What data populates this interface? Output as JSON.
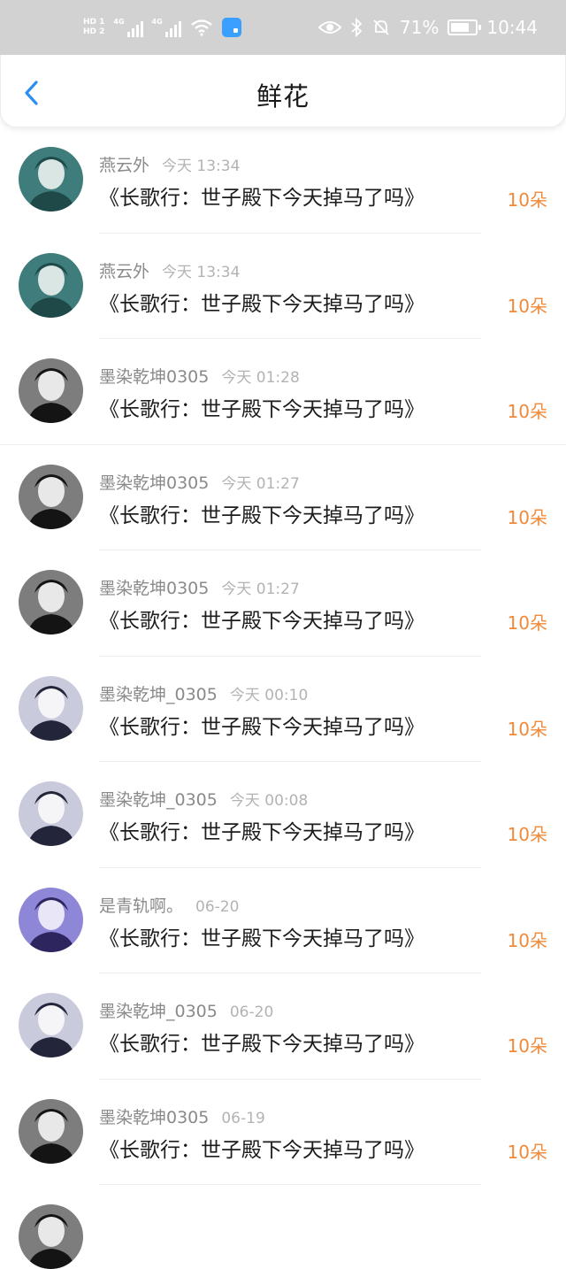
{
  "status_bar": {
    "hd1": "HD 1",
    "hd2": "HD 2",
    "net1": "4G",
    "net2": "4G",
    "battery": "71%",
    "time": "10:44"
  },
  "header": {
    "title": "鲜花",
    "back_icon": "chevron-left-icon"
  },
  "gifts": [
    {
      "user": "燕云外",
      "time": "今天 13:34",
      "book": "《长歌行：世子殿下今天掉马了吗》",
      "amount": "10朵",
      "avatar": "teal"
    },
    {
      "user": "燕云外",
      "time": "今天 13:34",
      "book": "《长歌行：世子殿下今天掉马了吗》",
      "amount": "10朵",
      "avatar": "teal"
    },
    {
      "user": "墨染乾坤0305",
      "time": "今天 01:28",
      "book": "《长歌行：世子殿下今天掉马了吗》",
      "amount": "10朵",
      "avatar": "dark"
    },
    {
      "user": "墨染乾坤0305",
      "time": "今天 01:27",
      "book": "《长歌行：世子殿下今天掉马了吗》",
      "amount": "10朵",
      "avatar": "dark"
    },
    {
      "user": "墨染乾坤0305",
      "time": "今天 01:27",
      "book": "《长歌行：世子殿下今天掉马了吗》",
      "amount": "10朵",
      "avatar": "dark"
    },
    {
      "user": "墨染乾坤_0305",
      "time": "今天 00:10",
      "book": "《长歌行：世子殿下今天掉马了吗》",
      "amount": "10朵",
      "avatar": "light"
    },
    {
      "user": "墨染乾坤_0305",
      "time": "今天 00:08",
      "book": "《长歌行：世子殿下今天掉马了吗》",
      "amount": "10朵",
      "avatar": "light"
    },
    {
      "user": "是青轨啊。",
      "time": "06-20",
      "book": "《长歌行：世子殿下今天掉马了吗》",
      "amount": "10朵",
      "avatar": "purple"
    },
    {
      "user": "墨染乾坤_0305",
      "time": "06-20",
      "book": "《长歌行：世子殿下今天掉马了吗》",
      "amount": "10朵",
      "avatar": "light"
    },
    {
      "user": "墨染乾坤0305",
      "time": "06-19",
      "book": "《长歌行：世子殿下今天掉马了吗》",
      "amount": "10朵",
      "avatar": "dark"
    }
  ],
  "colors": {
    "accent": "#f08a3a",
    "back": "#2b8ef0",
    "status_bar": "#d2d2d2"
  }
}
